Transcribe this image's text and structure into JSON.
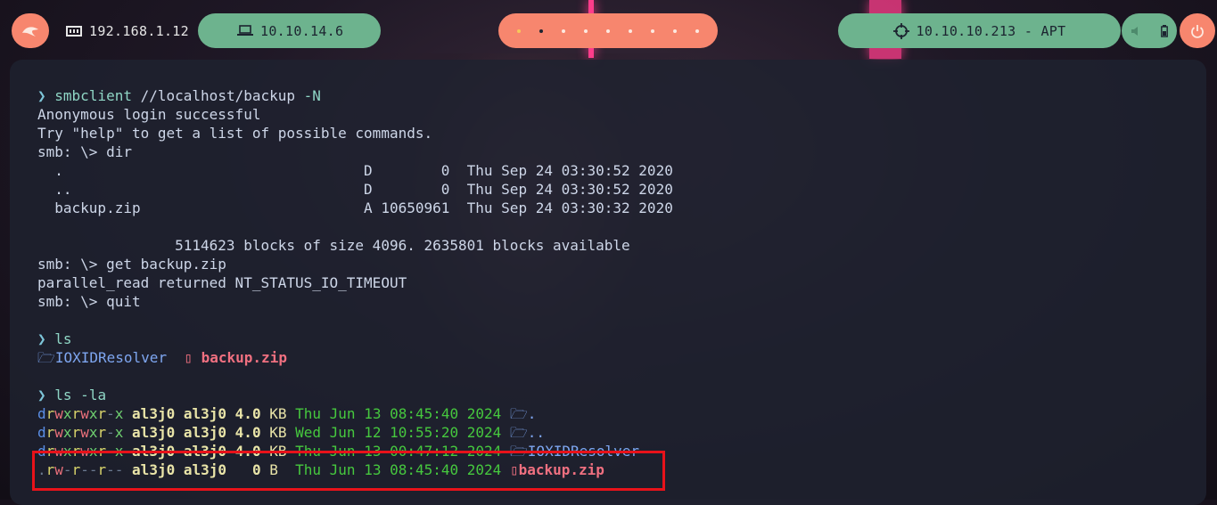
{
  "topbar": {
    "local_ip": "192.168.1.12",
    "vpn_ip": "10.10.14.6",
    "target": "10.10.10.213 - APT",
    "workspaces_count": 9,
    "active_workspace": 2
  },
  "colors": {
    "green_pill": "#6db38e",
    "orange_pill": "#f7866e",
    "terminal_bg": "#1e2230",
    "highlight": "#e8121a"
  },
  "terminal": {
    "prompt_symbol": "❯",
    "cmd1": "smbclient",
    "cmd1_arg": " //localhost/backup ",
    "cmd1_flag": "-N",
    "out1": "Anonymous login successful",
    "out2": "Try \"help\" to get a list of possible commands.",
    "smb_dir": "smb: \\> dir",
    "dir_rows": [
      "  .                                   D        0  Thu Sep 24 03:30:52 2020",
      "  ..                                  D        0  Thu Sep 24 03:30:52 2020",
      "  backup.zip                          A 10650961  Thu Sep 24 03:30:32 2020"
    ],
    "blocks": "                5114623 blocks of size 4096. 2635801 blocks available",
    "smb_get": "smb: \\> get backup.zip",
    "timeout": "parallel_read returned NT_STATUS_IO_TIMEOUT",
    "smb_quit": "smb: \\> quit",
    "cmd2": "ls",
    "ls_dir": "IOXIDResolver",
    "ls_zip": "backup.zip",
    "cmd3": "ls",
    "cmd3_flag": " -la",
    "la_rows": [
      {
        "perm": "drwxrwxr-x",
        "user": "al3j0",
        "group": "al3j0",
        "size": "4.0",
        "unit": "KB",
        "date": "Thu Jun 13 08:45:40 2024",
        "name": "."
      },
      {
        "perm": "drwxrwxr-x",
        "user": "al3j0",
        "group": "al3j0",
        "size": "4.0",
        "unit": "KB",
        "date": "Wed Jun 12 10:55:20 2024",
        "name": ".."
      },
      {
        "perm": "drwxrwxr-x",
        "user": "al3j0",
        "group": "al3j0",
        "size": "4.0",
        "unit": "KB",
        "date": "Thu Jun 13 00:47:12 2024",
        "name": "IOXIDResolver"
      },
      {
        "perm": ".rw-r--r--",
        "user": "al3j0",
        "group": "al3j0",
        "size": "  0",
        "unit": "B ",
        "date": "Thu Jun 13 08:45:40 2024",
        "name": "backup.zip"
      }
    ]
  }
}
